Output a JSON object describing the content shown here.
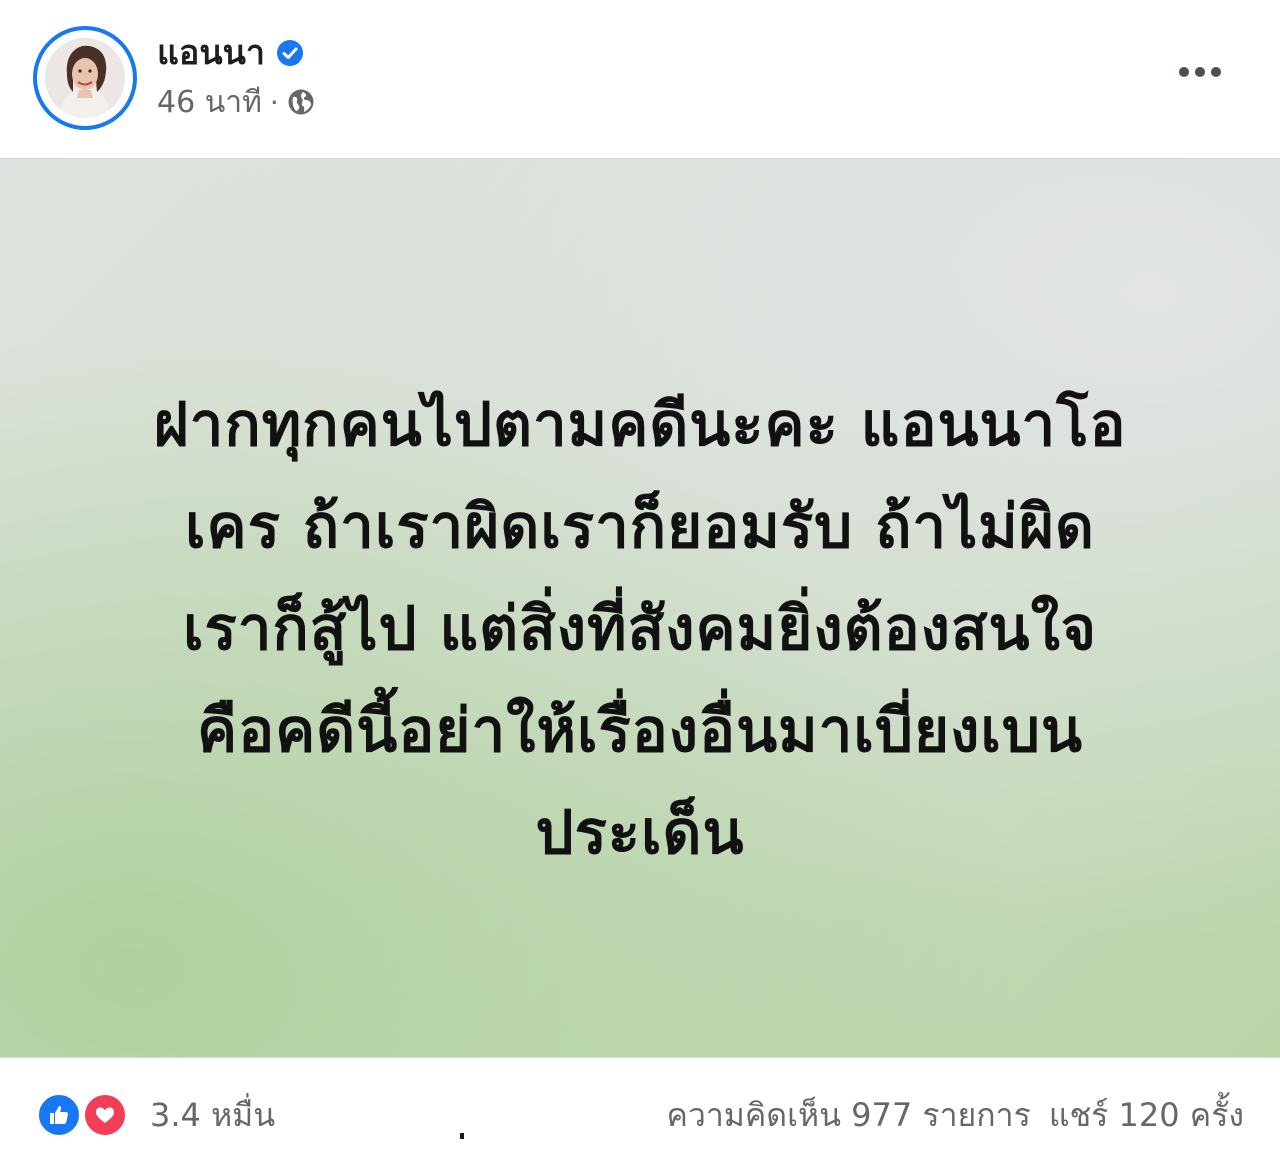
{
  "author": {
    "name": "แอนนา",
    "verified": true,
    "time": "46 นาที",
    "separator": "·",
    "audience_icon": "globe-icon"
  },
  "post": {
    "lines": [
      "ฝากทุกคนไปตามคดีนะคะ แอนนาโอ",
      "เคร ถ้าเราผิดเราก็ยอมรับ ถ้าไม่ผิด",
      "เราก็สู้ไป แต่สิ่งที่สังคมยิ่งต้องสนใจ",
      "คือคดีนี้อย่าให้เรื่องอื่นมาเบี่ยงเบน",
      "ประเด็น"
    ],
    "background_colors": [
      "#dfe3df",
      "#b9d5a8"
    ]
  },
  "footer": {
    "reaction_icons": [
      "like-icon",
      "love-icon"
    ],
    "reaction_count": "3.4 หมื่น",
    "comments": "ความคิดเห็น 977 รายการ",
    "shares": "แชร์ 120 ครั้ง"
  },
  "colors": {
    "accent": "#1877f2",
    "love": "#f33e58",
    "secondary_text": "#65676b"
  }
}
